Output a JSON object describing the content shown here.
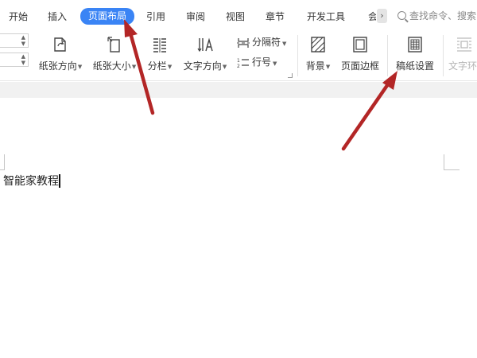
{
  "tabs": [
    {
      "label": "开始",
      "active": false
    },
    {
      "label": "插入",
      "active": false
    },
    {
      "label": "页面布局",
      "active": true
    },
    {
      "label": "引用",
      "active": false
    },
    {
      "label": "审阅",
      "active": false
    },
    {
      "label": "视图",
      "active": false
    },
    {
      "label": "章节",
      "active": false
    },
    {
      "label": "开发工具",
      "active": false
    },
    {
      "label": "会",
      "active": false
    }
  ],
  "tab_more_icon": "chevron-right-icon",
  "search": {
    "placeholder": "查找命令、搜索"
  },
  "ribbon": {
    "orientation": "纸张方向",
    "size": "纸张大小",
    "columns": "分栏",
    "text_direction": "文字方向",
    "breaks": "分隔符",
    "line_numbers": "行号",
    "background": "背景",
    "page_border": "页面边框",
    "manuscript": "稿纸设置",
    "text_wrap": "文字环"
  },
  "document": {
    "text": "智能家教程"
  },
  "colors": {
    "accent": "#3a84f5",
    "annotation_arrow": "#b32626"
  }
}
